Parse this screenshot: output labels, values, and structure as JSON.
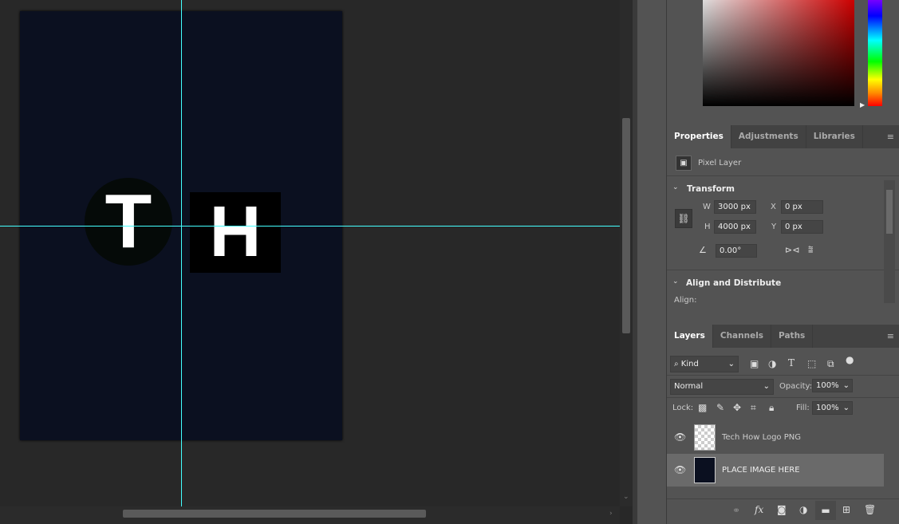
{
  "canvas": {
    "logo_letter_1": "T",
    "logo_letter_2": "H"
  },
  "properties": {
    "tabs": [
      "Properties",
      "Adjustments",
      "Libraries"
    ],
    "layer_type": "Pixel Layer",
    "transform": {
      "title": "Transform",
      "w_label": "W",
      "w": "3000 px",
      "h_label": "H",
      "h": "4000 px",
      "x_label": "X",
      "x": "0 px",
      "y_label": "Y",
      "y": "0 px",
      "angle": "0.00°"
    },
    "align": {
      "title": "Align and Distribute",
      "align_label": "Align:"
    }
  },
  "layers": {
    "tabs": [
      "Layers",
      "Channels",
      "Paths"
    ],
    "filter_kind": "Kind",
    "blend_mode": "Normal",
    "opacity_label": "Opacity:",
    "opacity": "100%",
    "lock_label": "Lock:",
    "fill_label": "Fill:",
    "fill": "100%",
    "items": [
      {
        "name": "Tech How Logo PNG",
        "visible": true,
        "selected": false
      },
      {
        "name": "PLACE IMAGE HERE",
        "visible": true,
        "selected": true
      }
    ]
  }
}
